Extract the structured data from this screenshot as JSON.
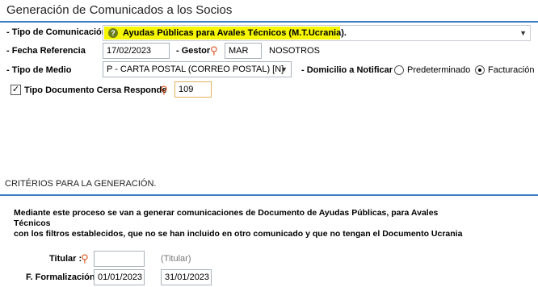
{
  "page": {
    "title": "Generación de Comunicados a los Socios"
  },
  "form": {
    "tipo_comunicacion": {
      "label": "- Tipo de Comunicación",
      "value": "Ayudas Públicas para Avales Técnicos (M.T.Ucrania)."
    },
    "fecha_referencia": {
      "label": "- Fecha Referencia",
      "value": "17/02/2023"
    },
    "gestor": {
      "label": "- Gestor",
      "code": "MAR",
      "name": "NOSOTROS"
    },
    "tipo_medio": {
      "label": "- Tipo de Medio",
      "value": "P - CARTA POSTAL  (CORREO POSTAL) [N]"
    },
    "domicilio": {
      "label": "- Domicilio a Notificar",
      "options": [
        "Predeterminado",
        "Facturación"
      ],
      "selected": "Facturación"
    },
    "tipo_documento": {
      "label": "Tipo Documento Cersa Responde",
      "value": "109",
      "checked": true
    }
  },
  "criterios": {
    "title": "CRITÉRIOS PARA LA GENERACIÓN.",
    "description_line1": "Mediante este proceso se van a generar comunicaciones de Documento de Ayudas Públicas, para Avales Técnicos",
    "description_line2": "con los filtros establecidos, que no se han incluido en otro comunicado y que no tengan el Documento Ucrania",
    "titular": {
      "label": "Titular :",
      "value": "",
      "hint": "(Titular)"
    },
    "formalizacion": {
      "label": "F. Formalización :",
      "from": "01/01/2023",
      "to": "31/01/2023"
    }
  },
  "icons": {
    "help": "help-icon",
    "search": "search-icon",
    "dropdown": "chevron-down-icon",
    "check": "checkmark-icon"
  },
  "colors": {
    "accent_rule": "#3f7fc1",
    "highlight": "#f6f600",
    "search_icon": "#d9531e"
  }
}
